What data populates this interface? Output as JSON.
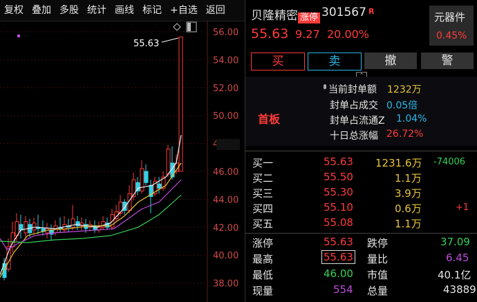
{
  "toolbar": {
    "items": [
      "复权",
      "叠加",
      "多股",
      "统计",
      "画线",
      "标记",
      "+自选",
      "返回"
    ]
  },
  "chart": {
    "price_ticks": [
      "56.00",
      "54.00",
      "52.00",
      "50.00",
      "48.00",
      "46.00",
      "44.00",
      "42.00",
      "40.00",
      "38.00"
    ],
    "peak_label": "55.63"
  },
  "stock": {
    "name": "贝隆精密",
    "limit_badge": "涨停",
    "code": "301567",
    "r_mark": "R",
    "price": "55.63",
    "change": "9.27",
    "change_pct": "20.00%",
    "sector": "元器件",
    "sector_pct": "0.45%"
  },
  "trade_buttons": {
    "buy": "买",
    "sell": "卖",
    "cancel": "撤",
    "alert": "警"
  },
  "seal": {
    "board_label": "首板",
    "rows": [
      {
        "label": "当前封单额",
        "value": "1232万"
      },
      {
        "label": "封单占成交",
        "value": "0.05倍"
      },
      {
        "label": "封单占流通Z",
        "value": "1.04%"
      },
      {
        "label": "十日总涨幅",
        "value": "26.72%"
      }
    ]
  },
  "order_book": [
    {
      "label": "买一",
      "price": "55.63",
      "vol": "1231.6万",
      "delta": "-74006"
    },
    {
      "label": "买二",
      "price": "55.50",
      "vol": "1.1万",
      "delta": ""
    },
    {
      "label": "买三",
      "price": "55.30",
      "vol": "3.9万",
      "delta": ""
    },
    {
      "label": "买四",
      "price": "55.10",
      "vol": "0.6万",
      "delta": "+1"
    },
    {
      "label": "买五",
      "price": "55.08",
      "vol": "1.1万",
      "delta": ""
    }
  ],
  "stats": {
    "limit_up_label": "涨停",
    "limit_up": "55.63",
    "limit_down_label": "跌停",
    "limit_down": "37.09",
    "high_label": "最高",
    "high": "55.63",
    "vol_ratio_label": "量比",
    "vol_ratio": "6.45",
    "low_label": "最低",
    "low": "46.00",
    "mkt_cap_label": "市值",
    "mkt_cap": "40.1亿",
    "cur_vol_label": "现量",
    "cur_vol": "554",
    "total_vol_label": "总量",
    "total_vol": "43889"
  },
  "colors": {
    "up": "#ff3b3b",
    "down": "#34d158",
    "ma5": "#f0f0f0",
    "ma10": "#e8c43a",
    "ma20": "#c04ae0",
    "ma60": "#34d158"
  }
}
